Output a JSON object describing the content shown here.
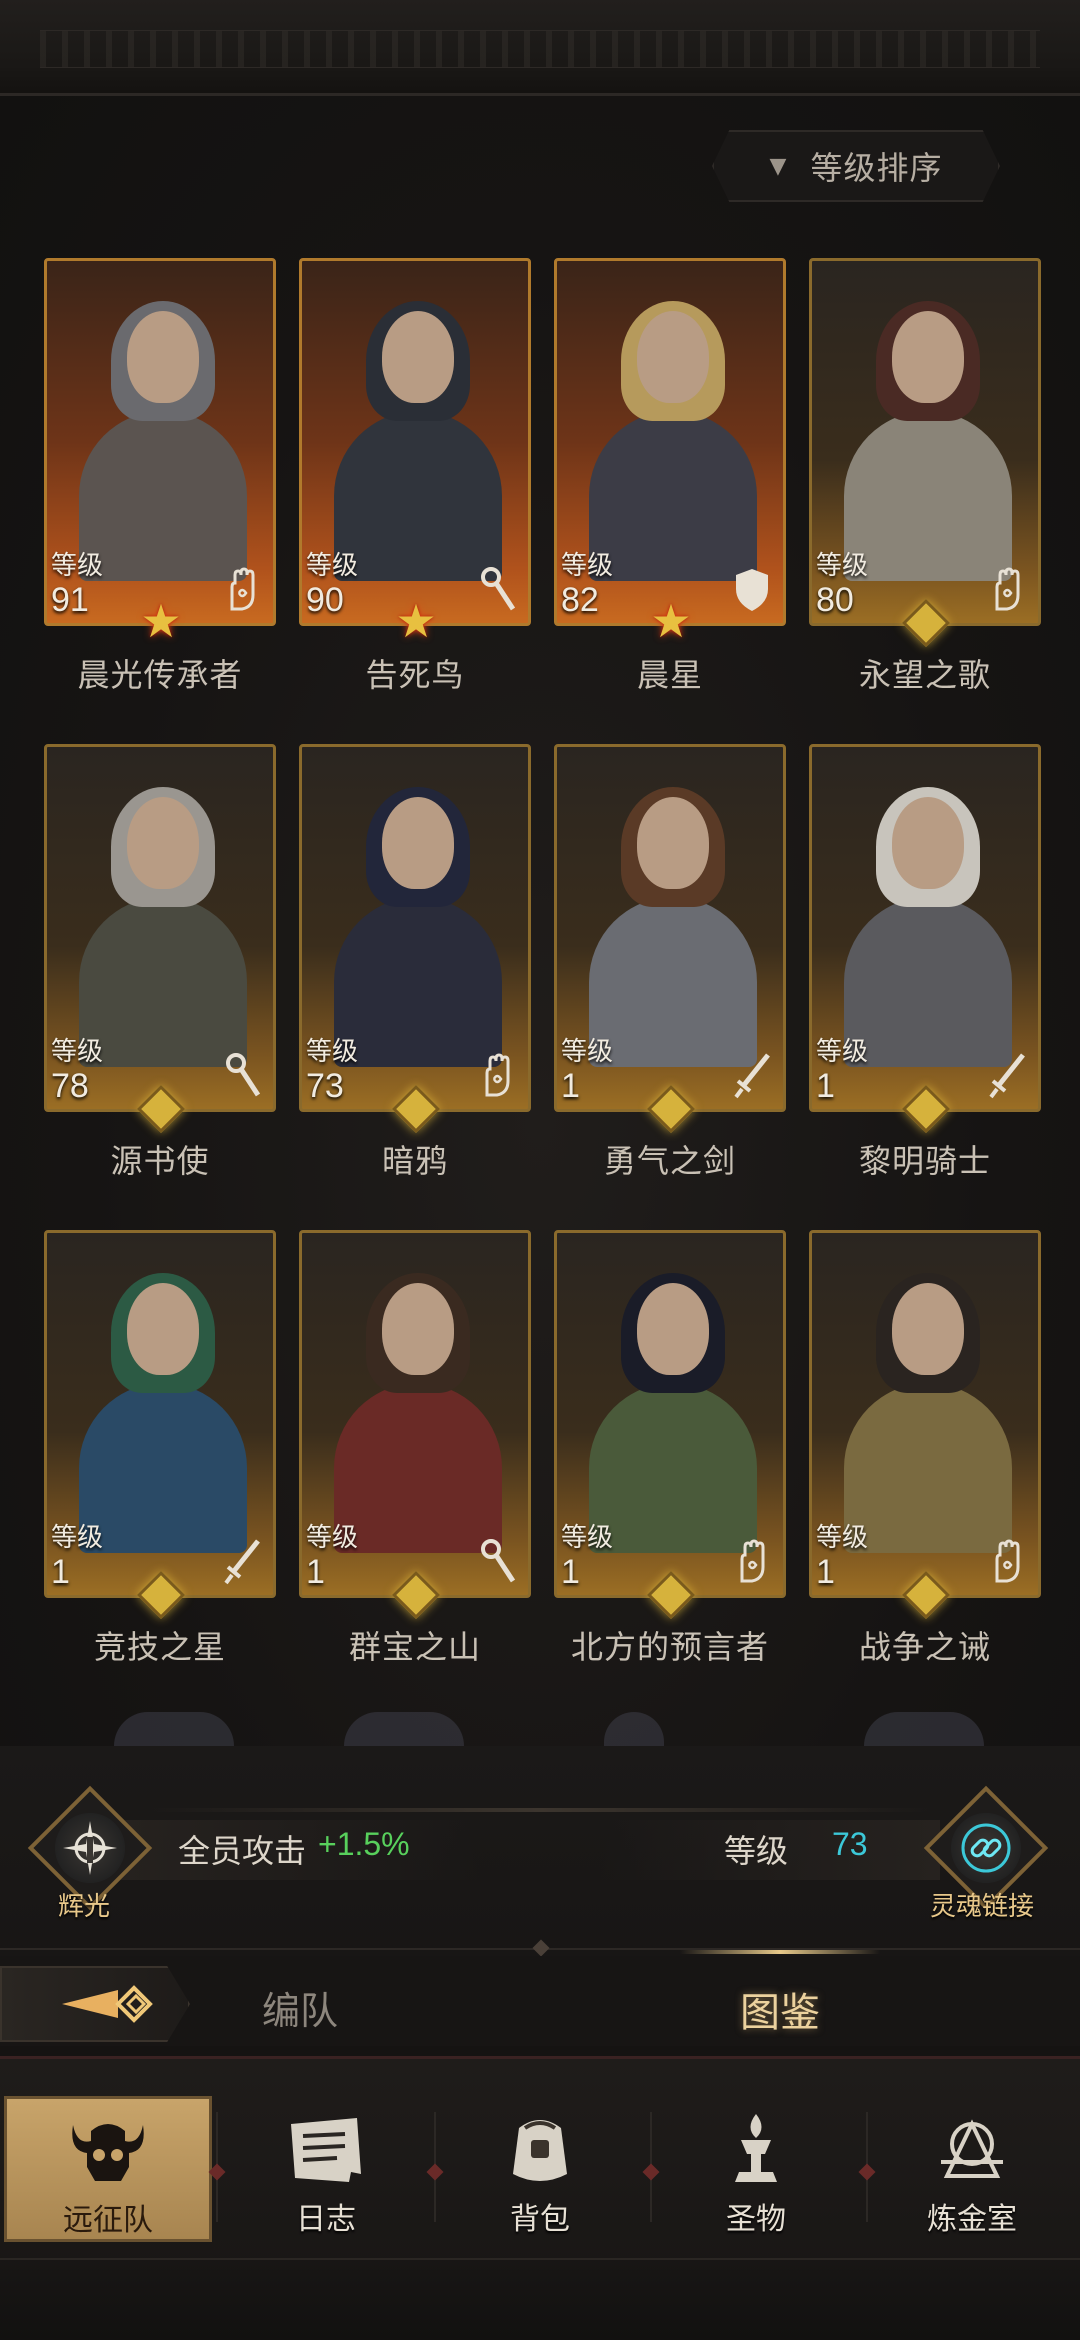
{
  "sort": {
    "label": "等级排序",
    "arrow": "▼"
  },
  "heroes": [
    {
      "name": "晨光传承者",
      "level_label": "等级",
      "level": "91",
      "class_icon": "hand-icon",
      "badge": "star",
      "frame": "orange",
      "hair": "#6a6a6e",
      "body": "#5b5450"
    },
    {
      "name": "告死鸟",
      "level_label": "等级",
      "level": "90",
      "class_icon": "staff-icon",
      "badge": "star",
      "frame": "orange",
      "hair": "#2a2e36",
      "body": "#30343c"
    },
    {
      "name": "晨星",
      "level_label": "等级",
      "level": "82",
      "class_icon": "shield-icon",
      "badge": "star",
      "frame": "orange",
      "hair": "#b69a5c",
      "body": "#3c3c46"
    },
    {
      "name": "永望之歌",
      "level_label": "等级",
      "level": "80",
      "class_icon": "hand-icon",
      "badge": "gem",
      "frame": "gold",
      "hair": "#4a2a24",
      "body": "#8a8478"
    },
    {
      "name": "源书使",
      "level_label": "等级",
      "level": "78",
      "class_icon": "staff-icon",
      "badge": "gem",
      "frame": "gold",
      "hair": "#9a9690",
      "body": "#4a4a40"
    },
    {
      "name": "暗鸦",
      "level_label": "等级",
      "level": "73",
      "class_icon": "hand-icon",
      "badge": "gem",
      "frame": "gold",
      "hair": "#22263a",
      "body": "#2a2c3a"
    },
    {
      "name": "勇气之剑",
      "level_label": "等级",
      "level": "1",
      "class_icon": "sword-icon",
      "badge": "gem",
      "frame": "gold",
      "hair": "#5a3a26",
      "body": "#6a6c72"
    },
    {
      "name": "黎明骑士",
      "level_label": "等级",
      "level": "1",
      "class_icon": "sword-icon",
      "badge": "gem",
      "frame": "gold",
      "hair": "#c8c4bc",
      "body": "#5a5a5e"
    },
    {
      "name": "竞技之星",
      "level_label": "等级",
      "level": "1",
      "class_icon": "sword-icon",
      "badge": "gem",
      "frame": "gold",
      "hair": "#2c5a44",
      "body": "#2a4a66"
    },
    {
      "name": "群宝之山",
      "level_label": "等级",
      "level": "1",
      "class_icon": "staff-icon",
      "badge": "gem",
      "frame": "gold",
      "hair": "#3a2a20",
      "body": "#6a2a26"
    },
    {
      "name": "北方的预言者",
      "level_label": "等级",
      "level": "1",
      "class_icon": "hand-icon",
      "badge": "gem",
      "frame": "gold",
      "hair": "#1a1c28",
      "body": "#4a5a3a"
    },
    {
      "name": "战争之诫",
      "level_label": "等级",
      "level": "1",
      "class_icon": "hand-icon",
      "badge": "gem",
      "frame": "gold",
      "hair": "#2a2420",
      "body": "#7a6a40"
    }
  ],
  "info": {
    "attack_label": "全员攻击",
    "attack_value": "+1.5%",
    "level_label": "等级",
    "level_value": "73",
    "left_emblem_label": "辉光",
    "right_emblem_label": "灵魂链接"
  },
  "tabs": {
    "team": "编队",
    "codex": "图鉴"
  },
  "nav": [
    {
      "label": "远征队",
      "icon": "skull-helmet-icon",
      "active": true
    },
    {
      "label": "日志",
      "icon": "journal-icon",
      "active": false
    },
    {
      "label": "背包",
      "icon": "bag-icon",
      "active": false
    },
    {
      "label": "圣物",
      "icon": "relic-icon",
      "active": false
    },
    {
      "label": "炼金室",
      "icon": "alchemy-icon",
      "active": false
    }
  ],
  "colors": {
    "accent_gold": "#d6b23c",
    "attack_green": "#58d05c",
    "level_cyan": "#3cc8d8"
  }
}
